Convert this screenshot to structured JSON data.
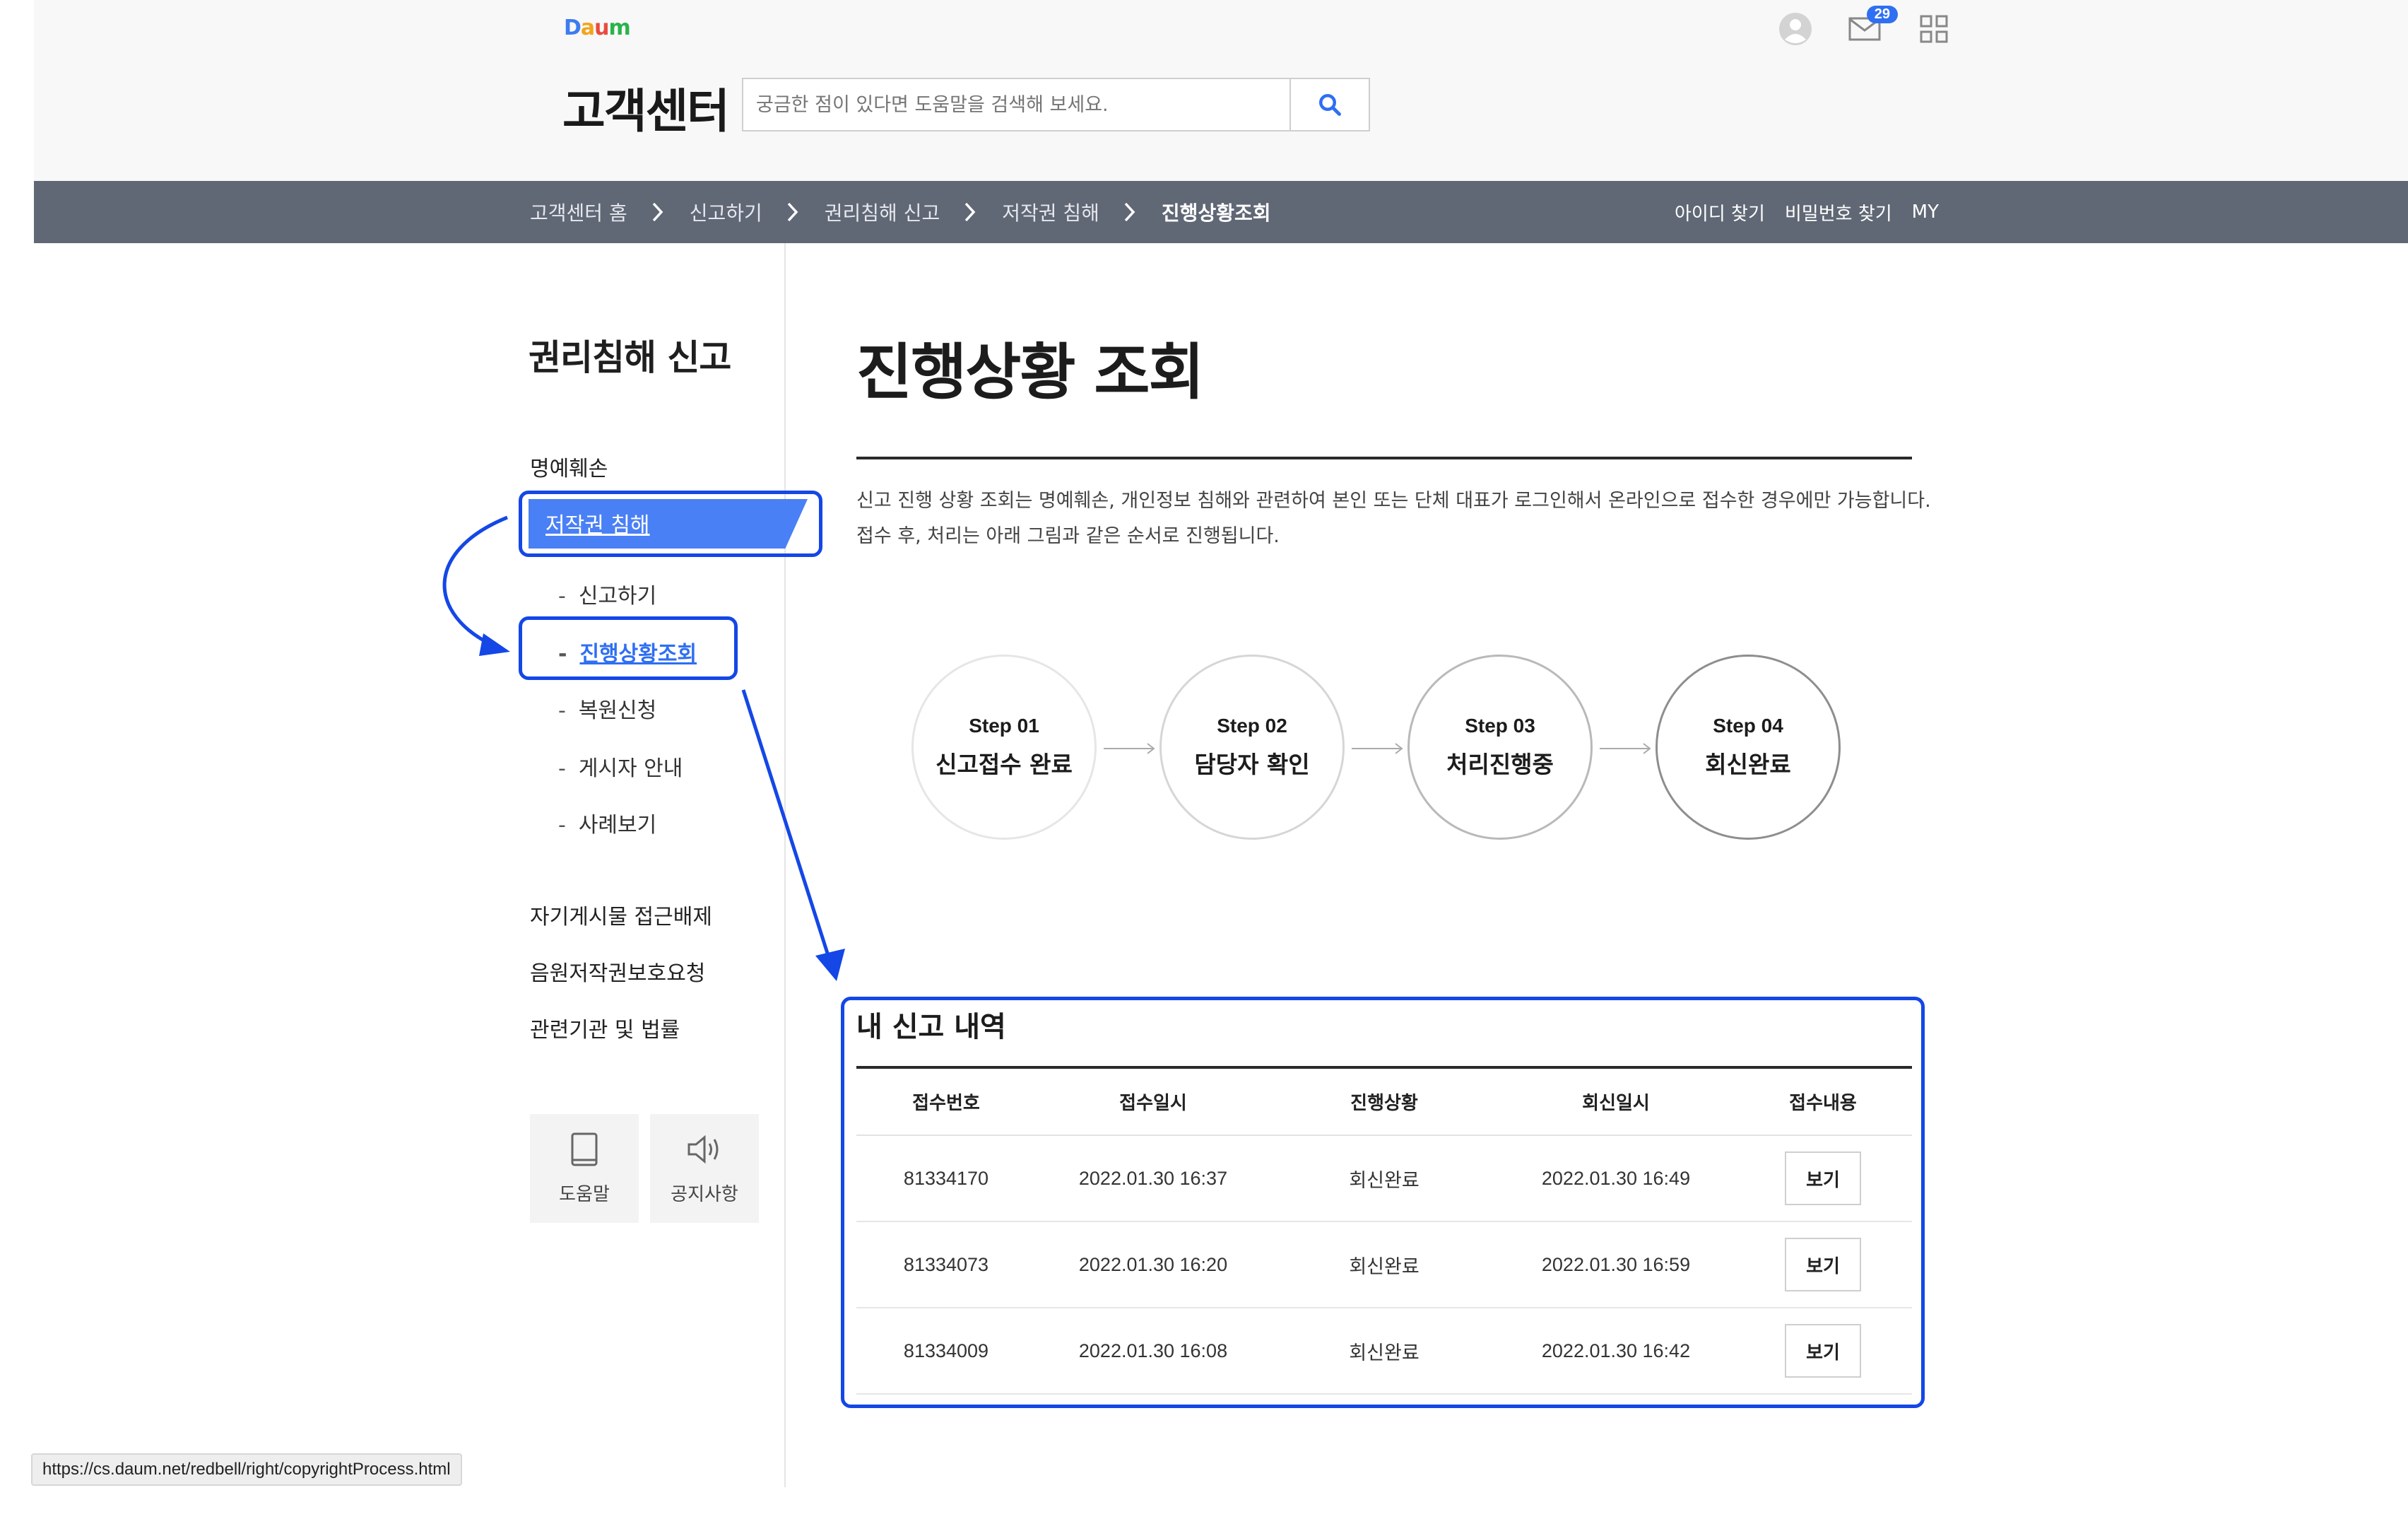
{
  "header": {
    "logo": [
      "D",
      "a",
      "u",
      "m"
    ],
    "title": "고객센터",
    "search": {
      "placeholder": "궁금한 점이 있다면 도움말을 검색해 보세요.",
      "value": ""
    },
    "mail_count": "29"
  },
  "breadcrumb": {
    "items": [
      "고객센터 홈",
      "신고하기",
      "권리침해 신고",
      "저작권 침해",
      "진행상황조회"
    ]
  },
  "util_links": [
    "아이디 찾기",
    "비밀번호 찾기",
    "MY"
  ],
  "sidebar": {
    "title": "권리침해 신고",
    "item_defamation": "명예훼손",
    "item_copyright": "저작권 침해",
    "sub_items": [
      "신고하기",
      "진행상황조회",
      "복원신청",
      "게시자 안내",
      "사례보기"
    ],
    "item_self_block": "자기게시물 접근배제",
    "item_music": "음원저작권보호요청",
    "item_law": "관련기관 및 법률",
    "quick": [
      {
        "label": "도움말",
        "icon": "book-icon"
      },
      {
        "label": "공지사항",
        "icon": "speaker-icon"
      }
    ]
  },
  "main": {
    "title": "진행상황 조회",
    "desc_line1": "신고 진행 상황 조회는 명예훼손, 개인정보 침해와 관련하여 본인 또는 단체 대표가 로그인해서 온라인으로 접수한 경우에만 가능합니다.",
    "desc_line2": "접수 후, 처리는 아래 그림과 같은 순서로 진행됩니다.",
    "steps": [
      {
        "no": "Step 01",
        "name": "신고접수 완료"
      },
      {
        "no": "Step 02",
        "name": "담당자 확인"
      },
      {
        "no": "Step 03",
        "name": "처리진행중"
      },
      {
        "no": "Step 04",
        "name": "회신완료"
      }
    ],
    "history": {
      "title": "내 신고 내역",
      "columns": [
        "접수번호",
        "접수일시",
        "진행상황",
        "회신일시",
        "접수내용"
      ],
      "rows": [
        {
          "id": "81334170",
          "received": "2022.01.30 16:37",
          "status": "회신완료",
          "replied": "2022.01.30 16:49",
          "action": "보기"
        },
        {
          "id": "81334073",
          "received": "2022.01.30 16:20",
          "status": "회신완료",
          "replied": "2022.01.30 16:59",
          "action": "보기"
        },
        {
          "id": "81334009",
          "received": "2022.01.30 16:08",
          "status": "회신완료",
          "replied": "2022.01.30 16:42",
          "action": "보기"
        }
      ]
    }
  },
  "statusbar": {
    "url": "https://cs.daum.net/redbell/right/copyrightProcess.html"
  },
  "colors": {
    "accent": "#4a80f5",
    "annotation": "#1447e6",
    "breadcrumb_bg": "#606775",
    "mail_badge": "#2f6ff2"
  }
}
